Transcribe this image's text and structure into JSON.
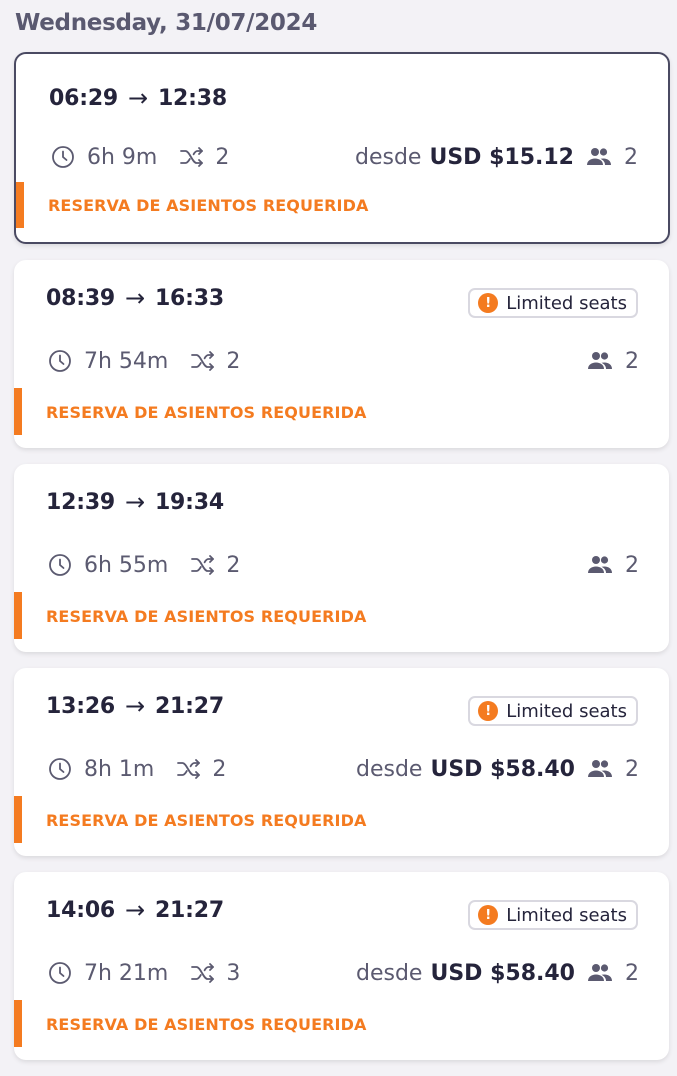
{
  "date_heading": "Wednesday, 31/07/2024",
  "colors": {
    "accent": "#f47b20",
    "text_dark": "#25243b",
    "text_muted": "#5b5a70"
  },
  "icons": {
    "duration": "clock-icon",
    "transfers": "shuffle-icon",
    "passengers": "people-icon",
    "limited": "exclamation-circle-icon",
    "arrow": "arrow-right-icon"
  },
  "trips": [
    {
      "depart": "06:29",
      "arrow": "→",
      "arrive": "12:38",
      "badge": "",
      "duration": "6h 9m",
      "transfers": "2",
      "price_label": "desde",
      "price": "USD $15.12",
      "passengers": "2",
      "notice": "RESERVA DE ASIENTOS REQUERIDA",
      "selected": true
    },
    {
      "depart": "08:39",
      "arrow": "→",
      "arrive": "16:33",
      "badge": "Limited seats",
      "duration": "7h 54m",
      "transfers": "2",
      "price_label": "",
      "price": "",
      "passengers": "2",
      "notice": "RESERVA DE ASIENTOS REQUERIDA",
      "selected": false
    },
    {
      "depart": "12:39",
      "arrow": "→",
      "arrive": "19:34",
      "badge": "",
      "duration": "6h 55m",
      "transfers": "2",
      "price_label": "",
      "price": "",
      "passengers": "2",
      "notice": "RESERVA DE ASIENTOS REQUERIDA",
      "selected": false
    },
    {
      "depart": "13:26",
      "arrow": "→",
      "arrive": "21:27",
      "badge": "Limited seats",
      "duration": "8h 1m",
      "transfers": "2",
      "price_label": "desde",
      "price": "USD $58.40",
      "passengers": "2",
      "notice": "RESERVA DE ASIENTOS REQUERIDA",
      "selected": false
    },
    {
      "depart": "14:06",
      "arrow": "→",
      "arrive": "21:27",
      "badge": "Limited seats",
      "duration": "7h 21m",
      "transfers": "3",
      "price_label": "desde",
      "price": "USD $58.40",
      "passengers": "2",
      "notice": "RESERVA DE ASIENTOS REQUERIDA",
      "selected": false
    }
  ]
}
